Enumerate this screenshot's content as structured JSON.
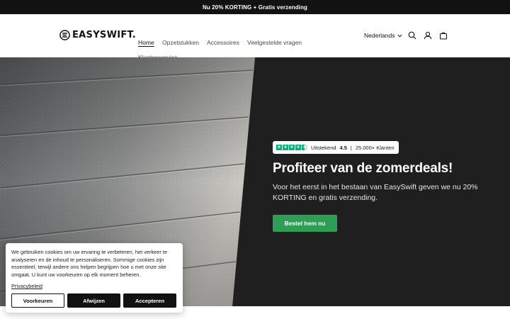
{
  "announcement": "Nu 20% KORTING + Gratis verzending",
  "header": {
    "brand": "EASYSWIFT.",
    "nav": [
      "Home",
      "Opzetstukken",
      "Accessoires",
      "Veelgestelde vragen",
      "Klantenservice"
    ],
    "language": "Nederlands"
  },
  "hero": {
    "trustpilot": {
      "rating_label": "Uitstekend",
      "rating": "4.5",
      "separator": "|",
      "customers": "25.000+ Klanten"
    },
    "title": "Profiteer van de zomerdeals!",
    "text": "Voor het eerst in het bestaan van EasySwift geven we nu 20% KORTING en gratis verzending.",
    "cta": "Bestel hem nu"
  },
  "cookie_banner": {
    "text": "We gebruiken cookies om uw ervaring te verbeteren, het verkeer te analyseren en de inhoud te personaliseren. Sommige cookies zijn essentieel, terwijl andere ons helpen begrijpen hoe u met onze site omgaat. U kunt uw voorkeuren op elk moment beheren.",
    "link": "Privacybeleid",
    "buttons": {
      "preferences": "Voorkeuren",
      "reject": "Afwijzen",
      "accept": "Accepteren"
    }
  },
  "colors": {
    "announcement_bg": "#121212",
    "hero_bg": "#1f1f1f",
    "cta_green": "#2e9e54",
    "trustpilot_green": "#00b67a"
  },
  "icons": [
    "search-icon",
    "account-icon",
    "cart-icon",
    "chevron-down-icon",
    "trustpilot-star-icon"
  ]
}
